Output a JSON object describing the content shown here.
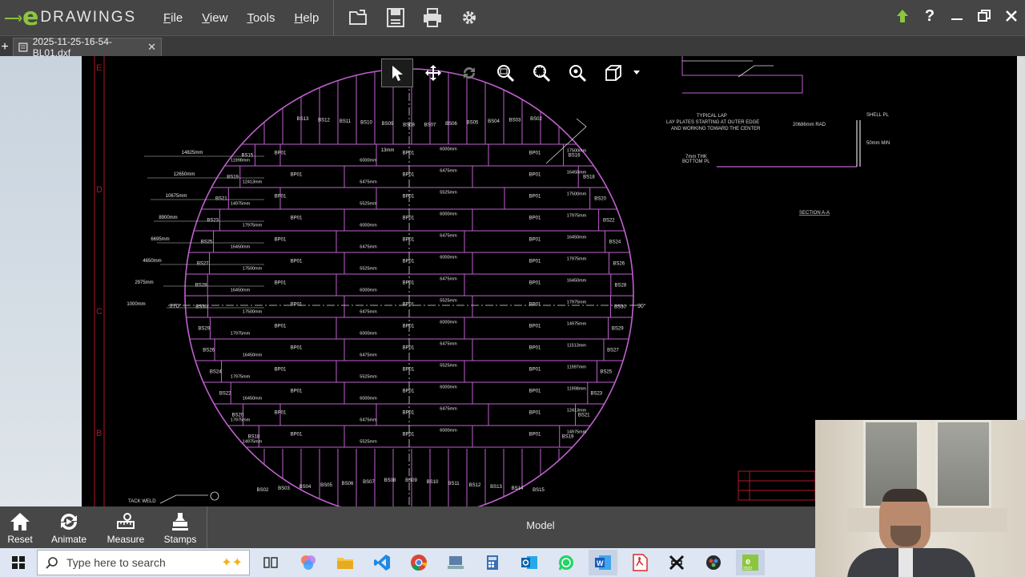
{
  "app": {
    "logo_text": "DRAWINGS",
    "menus": [
      "File",
      "View",
      "Tools",
      "Help"
    ],
    "toolbar_icons": [
      "open-folder-icon",
      "save-icon",
      "print-icon",
      "gear-icon"
    ],
    "window_controls": [
      "upload-arrow-icon",
      "help-icon",
      "minimize-icon",
      "restore-icon",
      "close-icon"
    ]
  },
  "tab": {
    "title": "2025-11-25-16-54-BL01.dxf",
    "close": "✕",
    "new": "+"
  },
  "canvas_tools": [
    "select-pointer-icon",
    "pan-icon",
    "rotate-icon",
    "zoom-window-icon",
    "zoom-fit-icon",
    "zoom-icon",
    "view-cube-icon",
    "dropdown-caret-icon"
  ],
  "drawing": {
    "row_labels": [
      "BS13",
      "BS12",
      "BS11",
      "BS10",
      "BS09",
      "BS08",
      "BS07",
      "BS06",
      "BS05",
      "BS04",
      "BS03",
      "BS02"
    ],
    "plate_label": "BP01",
    "edge_labels_left": [
      "BS15",
      "BS19",
      "BS21",
      "BS23",
      "BS25",
      "BS27",
      "BS28",
      "BS30",
      "BS29",
      "BS26",
      "BS24",
      "BS22",
      "BS20",
      "BS18",
      "BS16"
    ],
    "edge_labels_right": [
      "BS16",
      "BS18",
      "BS20",
      "BS22",
      "BS24",
      "BS26",
      "BS28",
      "BS30",
      "BS29",
      "BS27",
      "BS25",
      "BS23",
      "BS21",
      "BS19",
      "BS17"
    ],
    "bottom_labels": [
      "BS02",
      "BS03",
      "BS04",
      "BS05",
      "BS06",
      "BS07",
      "BS08",
      "BS09",
      "BS10",
      "BS11",
      "BS12",
      "BS13",
      "BS14",
      "BS15"
    ],
    "dims_left": [
      "14825mm",
      "12650mm",
      "10675mm",
      "8900mm",
      "6695mm",
      "4650mm",
      "2975mm",
      "1000mm"
    ],
    "dims_mid": [
      "11998mm",
      "12413mm",
      "14975mm",
      "17975mm",
      "16450mm",
      "17500mm",
      "16450mm",
      "17500mm",
      "17975mm",
      "16450mm",
      "17975mm",
      "16450mm",
      "17975mm",
      "14975mm",
      "11513mm",
      "11997mm"
    ],
    "dims_center": [
      "6000mm",
      "6475mm",
      "5525mm",
      "6000mm",
      "6475mm",
      "5525mm",
      "6000mm",
      "6475mm"
    ],
    "angle_left": "270°",
    "angle_right": "90°",
    "notes": [
      "TYPICAL LAP",
      "LAY PLATES STARTING AT OUTER EDGE",
      "AND WORKING TOWARD THE CENTER"
    ],
    "detail_labels": [
      "20686mm RAD",
      "SHELL PL",
      "50mm MIN",
      "7mm THK",
      "BOTTOM PL"
    ],
    "section_label": "SECTION A-A",
    "weld_label": "TACK WELD",
    "grid_letters": [
      "E",
      "D",
      "C",
      "B"
    ],
    "lap_label": "13mm"
  },
  "bottom_toolbar": {
    "buttons": [
      {
        "label": "Reset",
        "icon": "home-icon"
      },
      {
        "label": "Animate",
        "icon": "animate-icon"
      },
      {
        "label": "Measure",
        "icon": "measure-icon"
      },
      {
        "label": "Stamps",
        "icon": "stamp-icon"
      }
    ],
    "model_label": "Model"
  },
  "taskbar": {
    "search_placeholder": "Type here to search",
    "apps": [
      "task-view-icon",
      "copilot-icon",
      "file-explorer-icon",
      "vscode-icon",
      "chrome-icon",
      "network-icon",
      "calculator-icon",
      "outlook-icon",
      "whatsapp-icon",
      "word-icon",
      "pdf-icon",
      "capcut-icon",
      "davinci-icon",
      "edrawings-2022-icon"
    ]
  }
}
